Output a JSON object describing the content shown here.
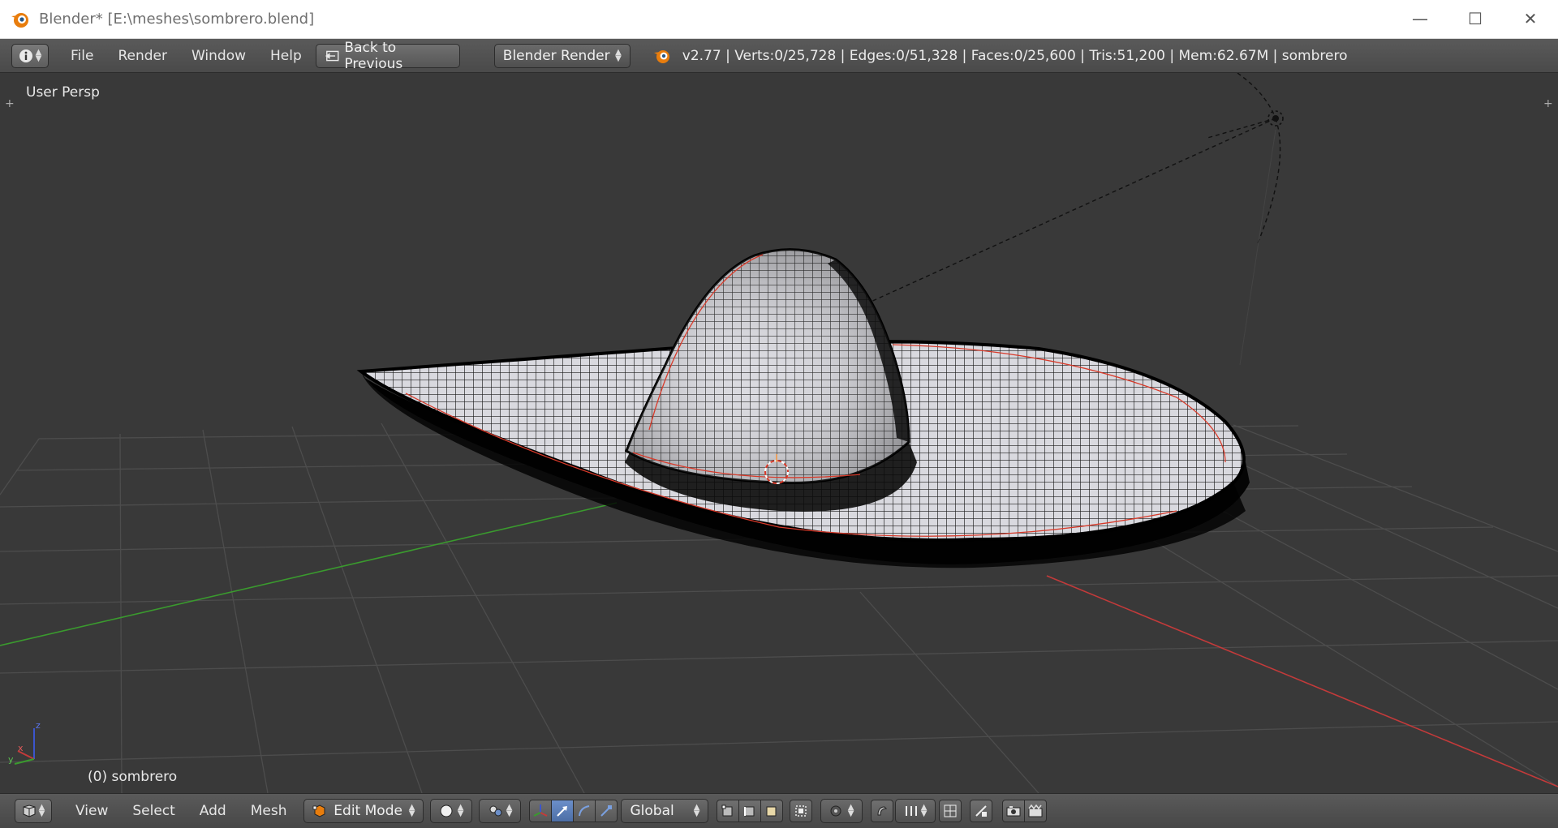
{
  "window": {
    "title": "Blender* [E:\\meshes\\sombrero.blend]",
    "controls": {
      "minimize": "—",
      "maximize": "☐",
      "close": "✕"
    }
  },
  "info_header": {
    "menus": [
      "File",
      "Render",
      "Window",
      "Help"
    ],
    "back_button_label": "Back to Previous",
    "render_engine": "Blender Render",
    "stats": "v2.77 | Verts:0/25,728 | Edges:0/51,328 | Faces:0/25,600 | Tris:51,200 | Mem:62.67M | sombrero"
  },
  "viewport": {
    "view_label": "User Persp",
    "object_label": "(0) sombrero",
    "axes": {
      "x": "x",
      "y": "y",
      "z": "z"
    }
  },
  "bottom_header": {
    "menus": [
      "View",
      "Select",
      "Add",
      "Mesh"
    ],
    "mode": "Edit Mode",
    "transform_orientation": "Global"
  },
  "colors": {
    "accent": "#e87d0d",
    "viewport_bg": "#393939",
    "header_bg": "#4f4f4f",
    "selected_blue": "#5680c2",
    "x_axis": "#c33a3a",
    "y_axis": "#3a9a2e",
    "z_axis": "#3b55cc"
  },
  "icons": [
    "blender-logo-icon",
    "info-editor-icon",
    "back-arrow-icon",
    "viewport-editor-icon",
    "edit-mode-icon",
    "solid-shading-icon",
    "pivot-icon",
    "manipulator-icon",
    "translate-icon",
    "rotate-icon",
    "scale-icon",
    "vertex-select-icon",
    "edge-select-icon",
    "face-select-icon",
    "occlude-icon",
    "proportional-icon",
    "snap-icon",
    "snap-element-icon",
    "render-icon",
    "render-anim-icon"
  ]
}
